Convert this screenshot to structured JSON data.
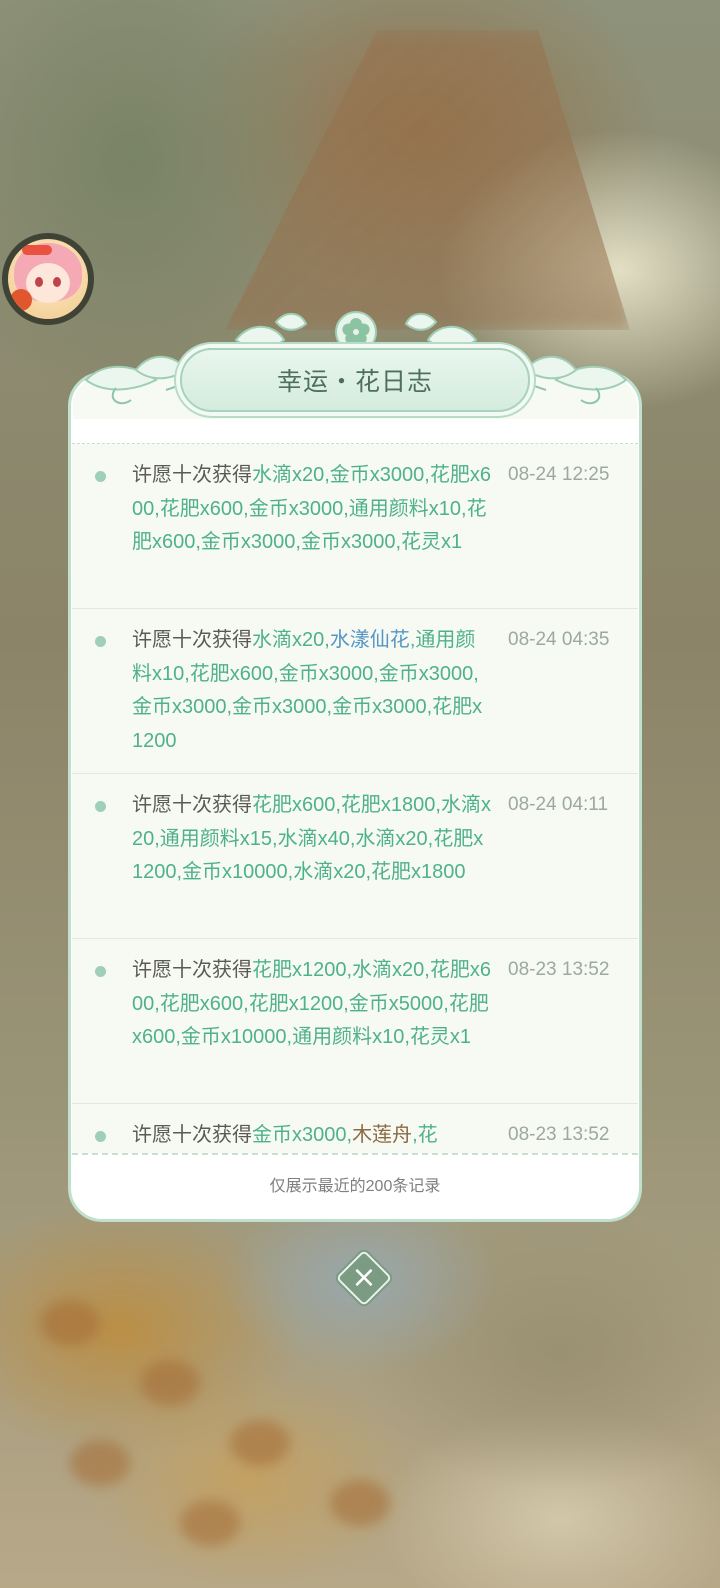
{
  "dialog": {
    "title": "幸运・花日志",
    "footer_note": "仅展示最近的200条记录",
    "close_icon": "close-icon"
  },
  "colors": {
    "lead_text": "#5c5a55",
    "reward_green": "#4fb18c",
    "reward_blue": "#5596c4",
    "reward_brown": "#8a6a43",
    "timestamp": "#9ca8a0"
  },
  "records": [
    {
      "segments": [
        {
          "t": "许愿十次获得",
          "c": "lead"
        },
        {
          "t": "水滴x20,金币x3000,花肥x600,花肥x600,金币x3000,通用颜料x10,花肥x600,金币x3000,金币x3000,花灵x1",
          "c": "green"
        }
      ],
      "time": "08-24 12:25"
    },
    {
      "segments": [
        {
          "t": "许愿十次获得",
          "c": "lead"
        },
        {
          "t": "水滴x20,",
          "c": "green"
        },
        {
          "t": "水漾仙花",
          "c": "blue"
        },
        {
          "t": ",通用颜料x10,花肥x600,金币x3000,金币x3000,金币x3000,金币x3000,金币x3000,花肥x1200",
          "c": "green"
        }
      ],
      "time": "08-24 04:35"
    },
    {
      "segments": [
        {
          "t": "许愿十次获得",
          "c": "lead"
        },
        {
          "t": "花肥x600,花肥x1800,水滴x20,通用颜料x15,水滴x40,水滴x20,花肥x1200,金币x10000,水滴x20,花肥x1800",
          "c": "green"
        }
      ],
      "time": "08-24 04:11"
    },
    {
      "segments": [
        {
          "t": "许愿十次获得",
          "c": "lead"
        },
        {
          "t": "花肥x1200,水滴x20,花肥x600,花肥x600,花肥x1200,金币x5000,花肥x600,金币x10000,通用颜料x10,花灵x1",
          "c": "green"
        }
      ],
      "time": "08-23 13:52"
    },
    {
      "segments": [
        {
          "t": "许愿十次获得",
          "c": "lead"
        },
        {
          "t": "金币x3000,",
          "c": "green"
        },
        {
          "t": "木莲舟",
          "c": "brown"
        },
        {
          "t": ",花",
          "c": "green"
        }
      ],
      "time": "08-23 13:52"
    }
  ]
}
